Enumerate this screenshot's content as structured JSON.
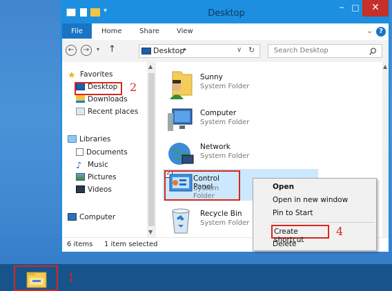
{
  "window": {
    "title": "Desktop",
    "controls": {
      "minimize": "–",
      "maximize": "□",
      "close": "✕"
    }
  },
  "ribbon": {
    "tabs": [
      "File",
      "Home",
      "Share",
      "View"
    ],
    "expand": "⌄",
    "help": "?"
  },
  "address": {
    "path": "Desktop",
    "separator": "▸",
    "dropdown": "∨",
    "refresh": "↻",
    "search_placeholder": "Search Desktop"
  },
  "navpane": {
    "favorites_label": "Favorites",
    "favorites": [
      "Desktop",
      "Downloads",
      "Recent places"
    ],
    "libraries_label": "Libraries",
    "libraries": [
      "Documents",
      "Music",
      "Pictures",
      "Videos"
    ],
    "computer_label": "Computer"
  },
  "folders": [
    {
      "name": "Sunny",
      "type": "System Folder"
    },
    {
      "name": "Computer",
      "type": "System Folder"
    },
    {
      "name": "Network",
      "type": "System Folder"
    },
    {
      "name": "Control Panel",
      "type": "System Folder"
    },
    {
      "name": "Recycle Bin",
      "type": "System Folder"
    }
  ],
  "status": {
    "items": "6 items",
    "selected": "1 item selected"
  },
  "context_menu": {
    "items": [
      "Open",
      "Open in new window",
      "Pin to Start",
      "Create shortcut",
      "Delete"
    ]
  },
  "annotations": [
    "1",
    "2",
    "3",
    "4"
  ],
  "icons": [
    "folder-icon",
    "star-icon",
    "library-icon",
    "document-icon",
    "music-icon",
    "picture-icon",
    "video-icon",
    "computer-icon",
    "network-icon",
    "control-panel-icon",
    "recycle-bin-icon",
    "user-icon",
    "search-icon",
    "file-explorer-icon"
  ],
  "colors": {
    "titlebar": "#1c8fe0",
    "close": "#c7302a",
    "annotation": "#d9261c",
    "selection": "#cce8ff",
    "taskbar": "#17548c"
  }
}
